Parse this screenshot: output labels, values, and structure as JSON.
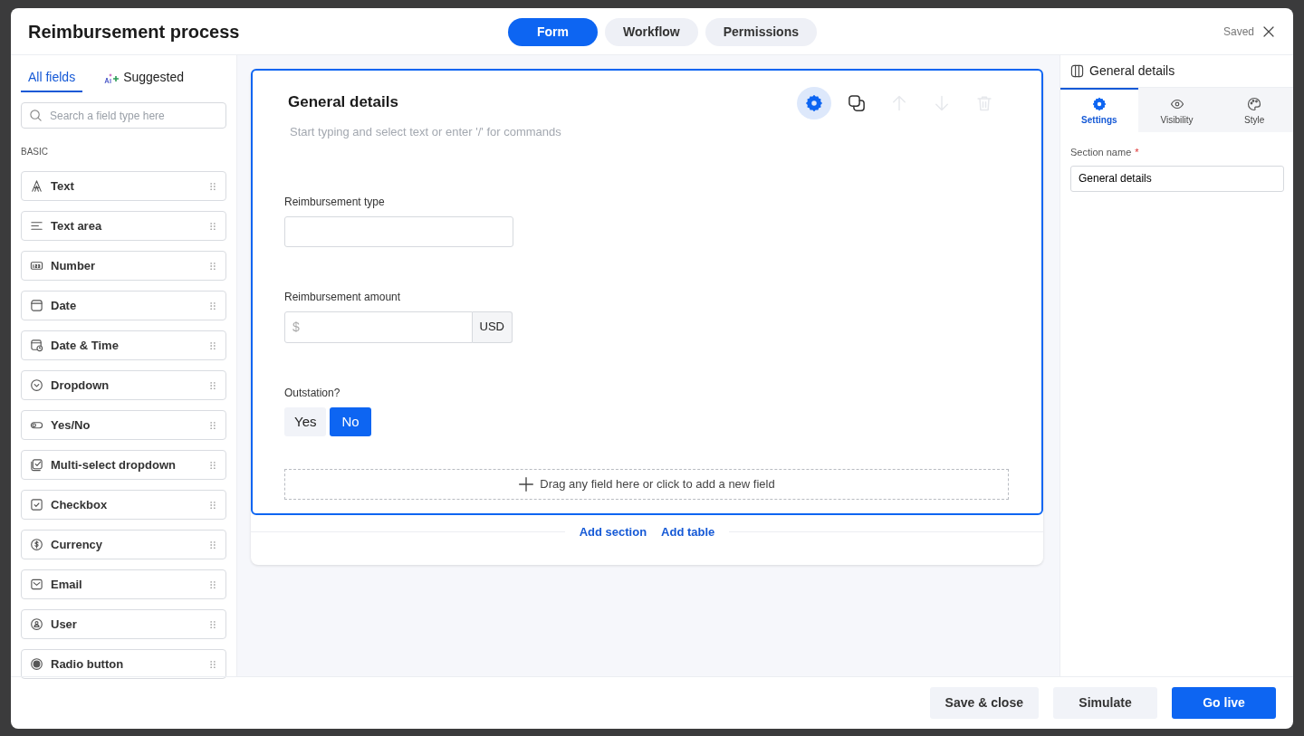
{
  "window": {
    "title": "Reimbursement process",
    "status": "Saved"
  },
  "view_tabs": [
    {
      "label": "Form",
      "selected": true
    },
    {
      "label": "Workflow",
      "selected": false
    },
    {
      "label": "Permissions",
      "selected": false
    }
  ],
  "sidebar": {
    "tabs": [
      {
        "label": "All fields",
        "selected": true,
        "kind": "plain"
      },
      {
        "label": "Suggested",
        "selected": false,
        "kind": "ai"
      }
    ],
    "search": {
      "placeholder": "Search a field type here"
    },
    "group": "BASIC",
    "items": [
      {
        "label": "Text",
        "kind": "text"
      },
      {
        "label": "Text area",
        "kind": "textarea"
      },
      {
        "label": "Number",
        "kind": "number"
      },
      {
        "label": "Date",
        "kind": "date"
      },
      {
        "label": "Date & Time",
        "kind": "datetime"
      },
      {
        "label": "Dropdown",
        "kind": "dropdown"
      },
      {
        "label": "Yes/No",
        "kind": "yesno"
      },
      {
        "label": "Multi-select dropdown",
        "kind": "multiselect"
      },
      {
        "label": "Checkbox",
        "kind": "checkbox"
      },
      {
        "label": "Currency",
        "kind": "currency"
      },
      {
        "label": "Email",
        "kind": "email"
      },
      {
        "label": "User",
        "kind": "user"
      },
      {
        "label": "Radio button",
        "kind": "radio"
      }
    ]
  },
  "section": {
    "title": "General details",
    "placeholder": "Start typing and select text or enter '/' for commands",
    "toolbar": [
      {
        "kind": "settings",
        "selected": true,
        "disabled": false
      },
      {
        "kind": "duplicate",
        "selected": false,
        "disabled": false
      },
      {
        "kind": "up",
        "selected": false,
        "disabled": true
      },
      {
        "kind": "down",
        "selected": false,
        "disabled": true
      },
      {
        "kind": "delete",
        "selected": false,
        "disabled": true
      }
    ],
    "fields": [
      {
        "kind": "text",
        "label": "Reimbursement type"
      },
      {
        "kind": "currency",
        "label": "Reimbursement amount",
        "placeholder": "$",
        "unit": "USD"
      },
      {
        "kind": "yesno",
        "label": "Outstation?",
        "options": [
          {
            "label": "Yes",
            "selected": false
          },
          {
            "label": "No",
            "selected": true
          }
        ]
      }
    ],
    "drop_zone": "Drag any field here or click to add a new field"
  },
  "add_links": [
    "Add section",
    "Add table"
  ],
  "properties": {
    "title": "General details",
    "tabs": [
      {
        "label": "Settings",
        "kind": "settings",
        "selected": true
      },
      {
        "label": "Visibility",
        "kind": "visibility",
        "selected": false
      },
      {
        "label": "Style",
        "kind": "style",
        "selected": false
      }
    ],
    "field_label": "Section name",
    "required_mark": "*",
    "value": "General details"
  },
  "footer_buttons": [
    {
      "label": "Save & close",
      "kind": "secondary"
    },
    {
      "label": "Simulate",
      "kind": "secondary"
    },
    {
      "label": "Go live",
      "kind": "primary"
    }
  ]
}
